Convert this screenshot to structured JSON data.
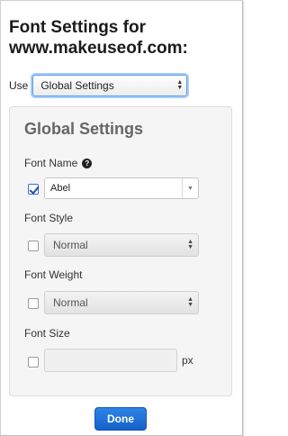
{
  "header": {
    "title": "Font Settings for www.makeuseof.com:"
  },
  "use": {
    "label": "Use",
    "selected": "Global Settings"
  },
  "panel": {
    "title": "Global Settings",
    "font_name": {
      "label": "Font Name",
      "value": "Abel",
      "checked": true
    },
    "font_style": {
      "label": "Font Style",
      "value": "Normal",
      "checked": false
    },
    "font_weight": {
      "label": "Font Weight",
      "value": "Normal",
      "checked": false
    },
    "font_size": {
      "label": "Font Size",
      "value": "",
      "unit": "px",
      "checked": false
    }
  },
  "actions": {
    "done_label": "Done"
  },
  "colors": {
    "accent": "#1f6fd8",
    "focus_ring": "#a8cdf5"
  },
  "icons": {
    "help": "question-circle-icon",
    "select_arrows": "up-down-arrows-icon"
  }
}
